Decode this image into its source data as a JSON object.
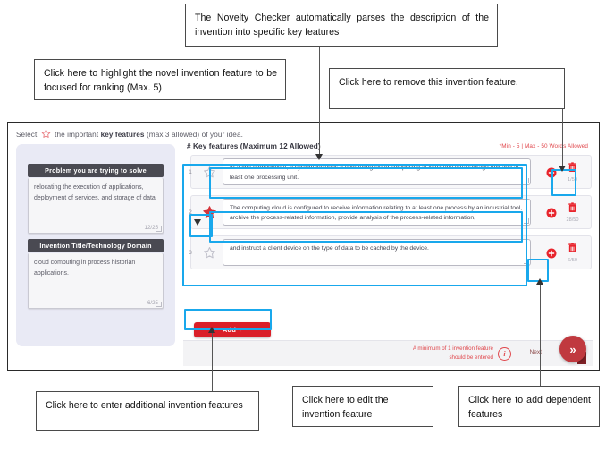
{
  "annotations": [
    {
      "id": "a-parse",
      "text": "The Novelty Checker automatically parses the description of the invention into specific key features"
    },
    {
      "id": "a-star",
      "text": "Click here to highlight the novel invention feature to be focused for ranking (Max. 5)"
    },
    {
      "id": "a-remove",
      "text": "Click here to remove this invention feature."
    },
    {
      "id": "a-add",
      "text": "Click here to enter additional invention features"
    },
    {
      "id": "a-edit",
      "text": "Click here to edit the invention feature"
    },
    {
      "id": "a-depend",
      "text": "Click here to add dependent features"
    }
  ],
  "app": {
    "select_line": {
      "prefix": "Select",
      "middle": "the important",
      "bold": "key features",
      "suffix": "(max 3 allowed) of your idea."
    },
    "left_panel": {
      "cards": [
        {
          "title": "Problem you are trying to solve",
          "text": "relocating the execution of applications, deployment of services, and storage of data",
          "counter": "12/25"
        },
        {
          "title": "Invention Title/Technology Domain",
          "text": "cloud computing in process historian applications.",
          "counter": "6/25"
        }
      ]
    },
    "features": {
      "title": "# Key features (Maximum 12 Allowed)",
      "hint": "*Min - 5 | Max - 50 Words Allowed",
      "rows": [
        {
          "num": "1",
          "star": "star-outline-icon",
          "starred": false,
          "text": "In a first embodiment, a system includes a computing cloud comprising at least one data storage unit and  at least one processing unit.",
          "counter": "1/50"
        },
        {
          "num": "2",
          "star": "star-filled-icon",
          "starred": true,
          "text": "The computing cloud is configured to receive information relating to at least one process by an industrial tool, archive the process-related information, provide analysis of the process-related information,",
          "counter": "28/50"
        },
        {
          "num": "3",
          "star": "star-outline-icon",
          "starred": false,
          "text": "and instruct a client device on the type of data to be cached by the device.",
          "counter": "6/50"
        }
      ],
      "add_label": "Add +"
    },
    "footer": {
      "warning": "A minimum of 1 invention feature should be entered",
      "info_icon": "info-circle-icon",
      "next_label": "Next",
      "next_button_glyph": "»"
    }
  },
  "colors": {
    "highlight": "#19a8ec",
    "brand_red": "#da1f28",
    "star_red": "#d6353b",
    "panel_lavender": "#e9eaf5"
  }
}
